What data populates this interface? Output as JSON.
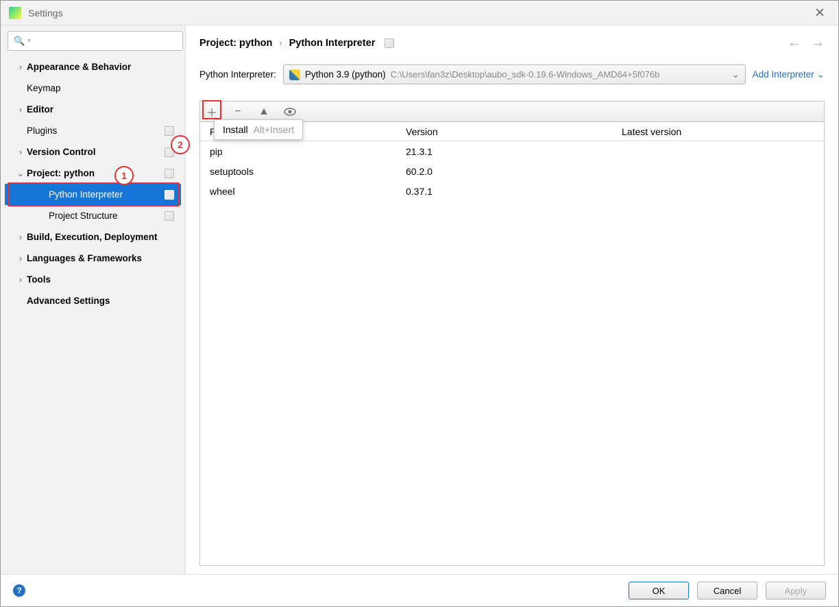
{
  "window": {
    "title": "Settings"
  },
  "sidebar": {
    "search_placeholder": "",
    "items": [
      {
        "label": "Appearance & Behavior",
        "expandable": true,
        "depth": 0
      },
      {
        "label": "Keymap",
        "expandable": false,
        "depth": 0,
        "leaf": true
      },
      {
        "label": "Editor",
        "expandable": true,
        "depth": 0
      },
      {
        "label": "Plugins",
        "expandable": false,
        "depth": 0,
        "leaf": true,
        "icon": true
      },
      {
        "label": "Version Control",
        "expandable": true,
        "depth": 0,
        "icon": true
      },
      {
        "label": "Project: python",
        "expandable": true,
        "expanded": true,
        "depth": 0,
        "icon": true,
        "annotation": "1"
      },
      {
        "label": "Python Interpreter",
        "expandable": false,
        "depth": 1,
        "leaf": true,
        "icon": true,
        "selected": true
      },
      {
        "label": "Project Structure",
        "expandable": false,
        "depth": 1,
        "leaf": true,
        "icon": true
      },
      {
        "label": "Build, Execution, Deployment",
        "expandable": true,
        "depth": 0
      },
      {
        "label": "Languages & Frameworks",
        "expandable": true,
        "depth": 0
      },
      {
        "label": "Tools",
        "expandable": true,
        "depth": 0
      },
      {
        "label": "Advanced Settings",
        "expandable": false,
        "depth": 0
      }
    ]
  },
  "breadcrumb": {
    "items": [
      "Project: python",
      "Python Interpreter"
    ]
  },
  "interpreter": {
    "label": "Python Interpreter:",
    "name": "Python 3.9 (python)",
    "path": "C:\\Users\\fan3z\\Desktop\\aubo_sdk-0.19.6-Windows_AMD64+5f076b",
    "add_label": "Add Interpreter"
  },
  "toolbar": {
    "annotation": "2",
    "tooltip": {
      "label": "Install",
      "shortcut": "Alt+Insert"
    }
  },
  "packages": {
    "headers": {
      "package": "Package",
      "version": "Version",
      "latest": "Latest version"
    },
    "rows": [
      {
        "name": "pip",
        "version": "21.3.1"
      },
      {
        "name": "setuptools",
        "version": "60.2.0"
      },
      {
        "name": "wheel",
        "version": "0.37.1"
      }
    ]
  },
  "footer": {
    "ok": "OK",
    "cancel": "Cancel",
    "apply": "Apply"
  }
}
